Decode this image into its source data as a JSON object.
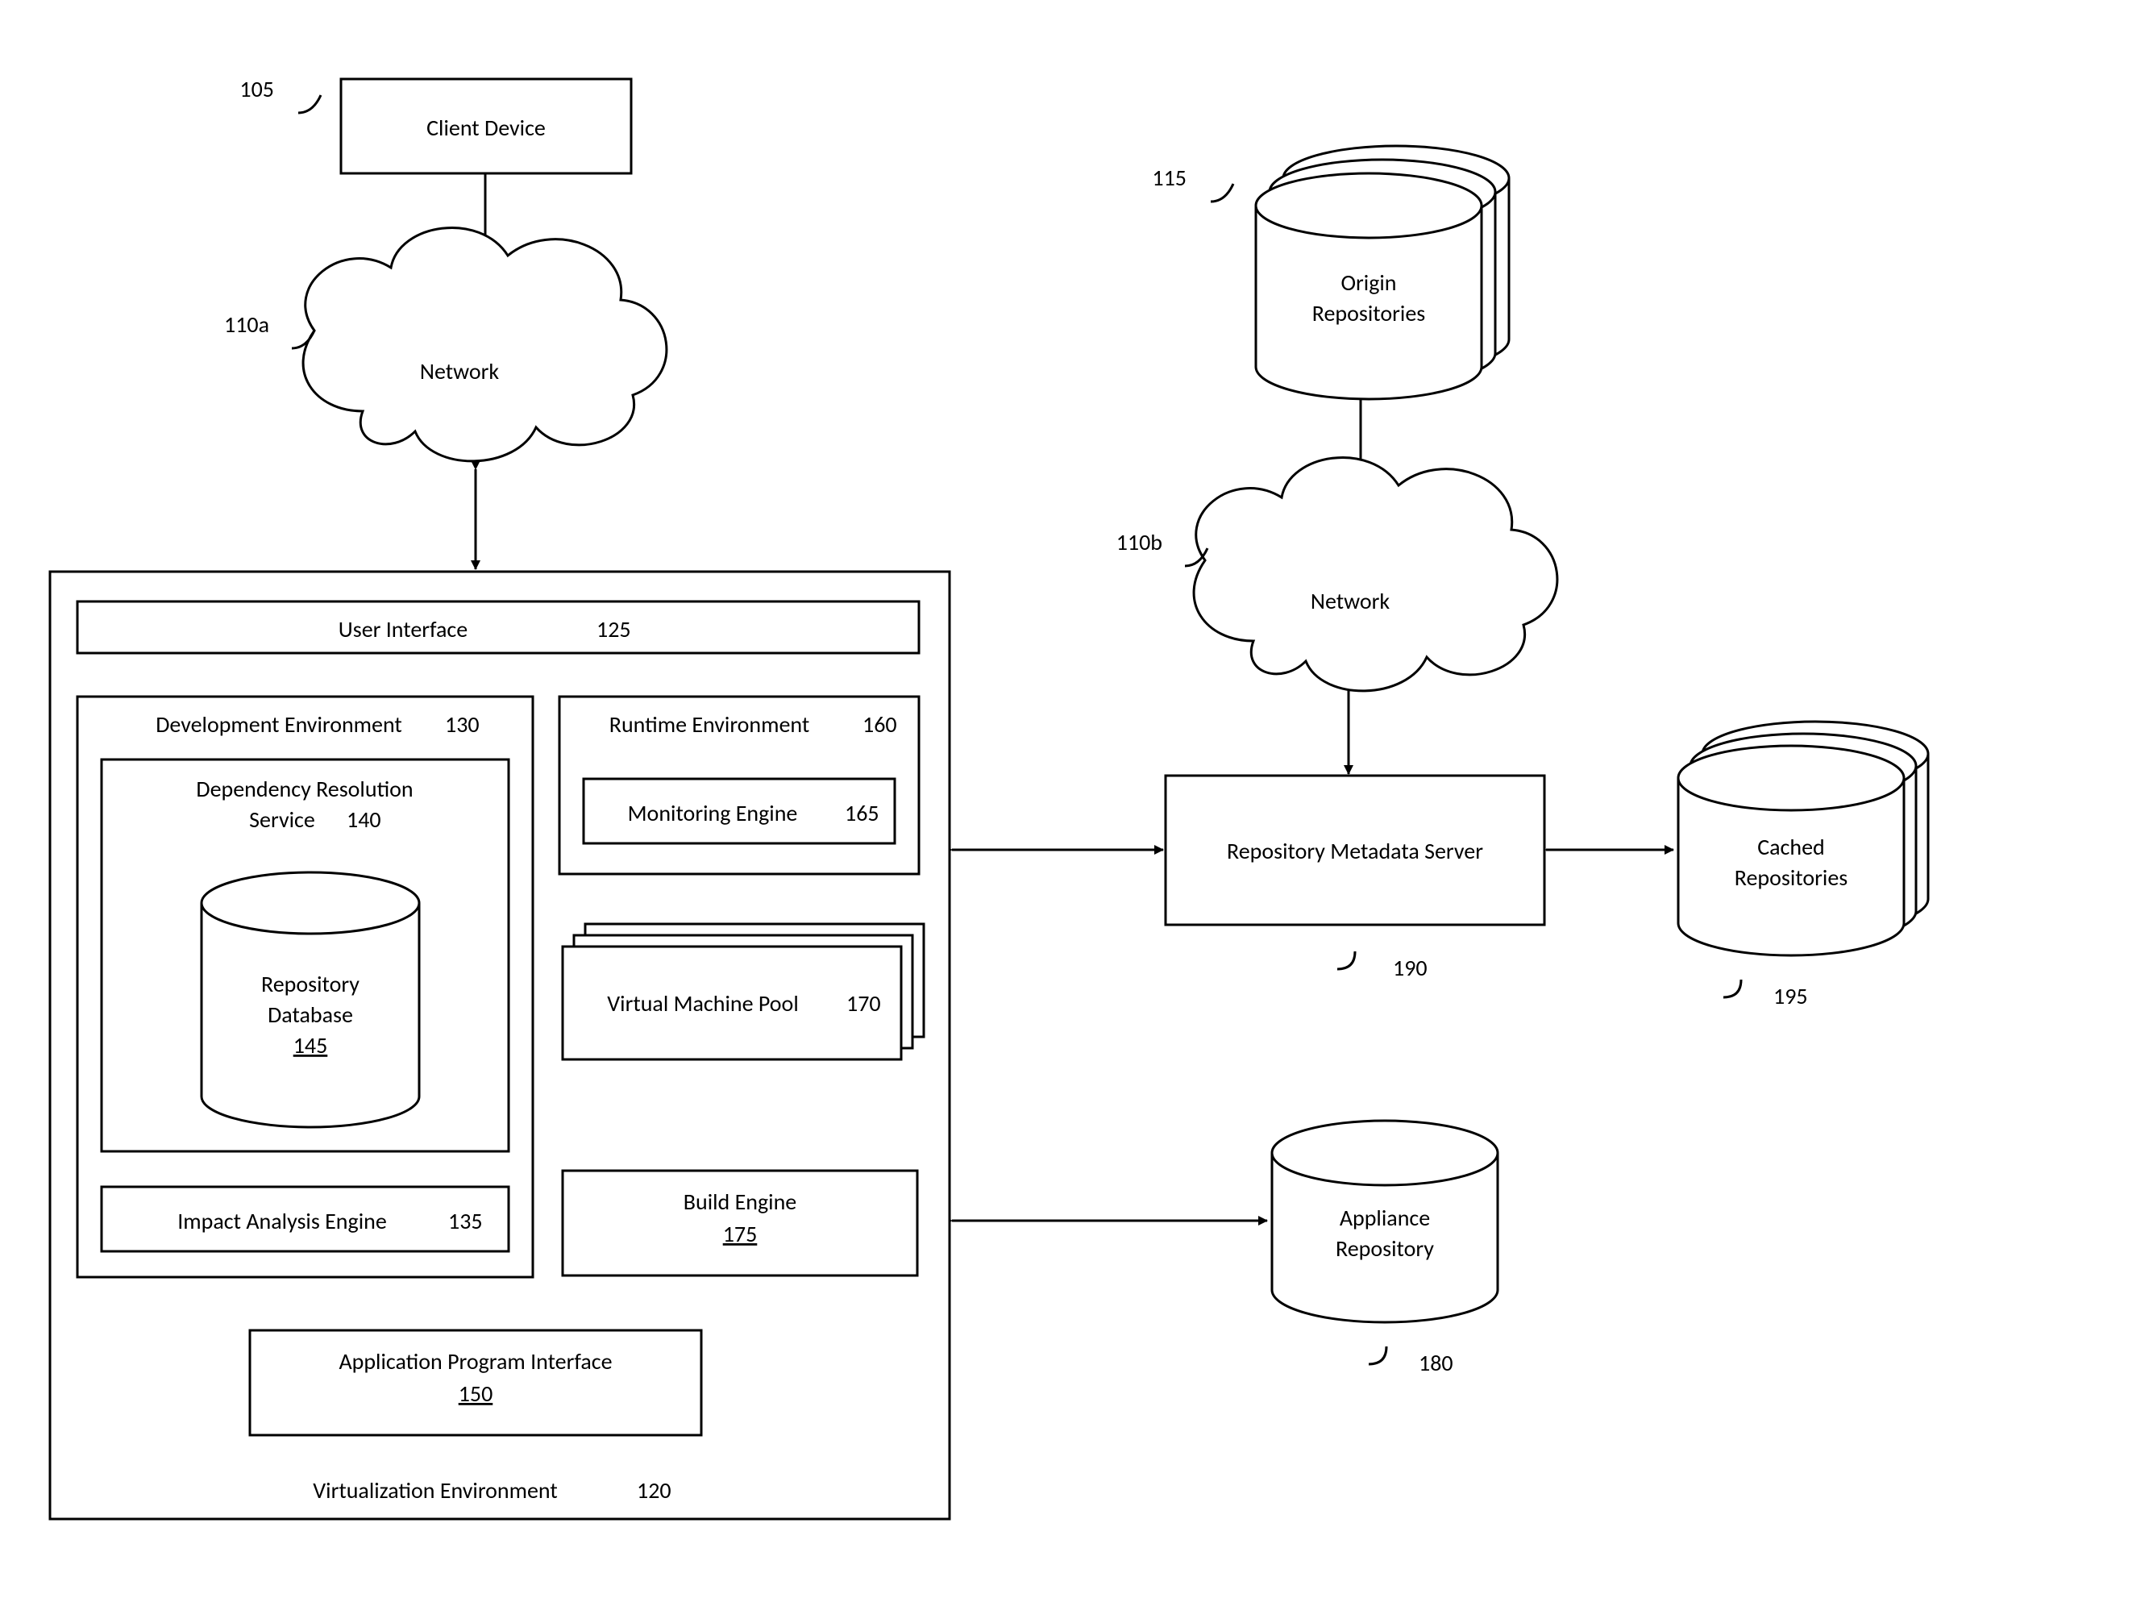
{
  "nodes": {
    "client": {
      "label": "Client Device",
      "ref": "105"
    },
    "net_a": {
      "label": "Network",
      "ref": "110a"
    },
    "net_b": {
      "label": "Network",
      "ref": "110b"
    },
    "origin": {
      "label1": "Origin",
      "label2": "Repositories",
      "ref": "115"
    },
    "virt_env": {
      "label": "Virtualization Environment",
      "ref": "120"
    },
    "ui": {
      "label": "User Interface",
      "ref": "125"
    },
    "dev_env": {
      "label": "Development Environment",
      "ref": "130"
    },
    "impact": {
      "label": "Impact Analysis Engine",
      "ref": "135"
    },
    "dep_res": {
      "label1": "Dependency Resolution",
      "label2": "Service",
      "ref": "140"
    },
    "repo_db": {
      "label1": "Repository",
      "label2": "Database",
      "ref": "145"
    },
    "api": {
      "label1": "Application Program Interface",
      "ref": "150"
    },
    "rt_env": {
      "label": "Runtime Environment",
      "ref": "160"
    },
    "mon_eng": {
      "label": "Monitoring Engine",
      "ref": "165"
    },
    "vm_pool": {
      "label": "Virtual Machine Pool",
      "ref": "170"
    },
    "build": {
      "label1": "Build Engine",
      "ref": "175"
    },
    "app_repo": {
      "label1": "Appliance",
      "label2": "Repository",
      "ref": "180"
    },
    "meta": {
      "label": "Repository Metadata Server",
      "ref": "190"
    },
    "cached": {
      "label1": "Cached",
      "label2": "Repositories",
      "ref": "195"
    }
  }
}
